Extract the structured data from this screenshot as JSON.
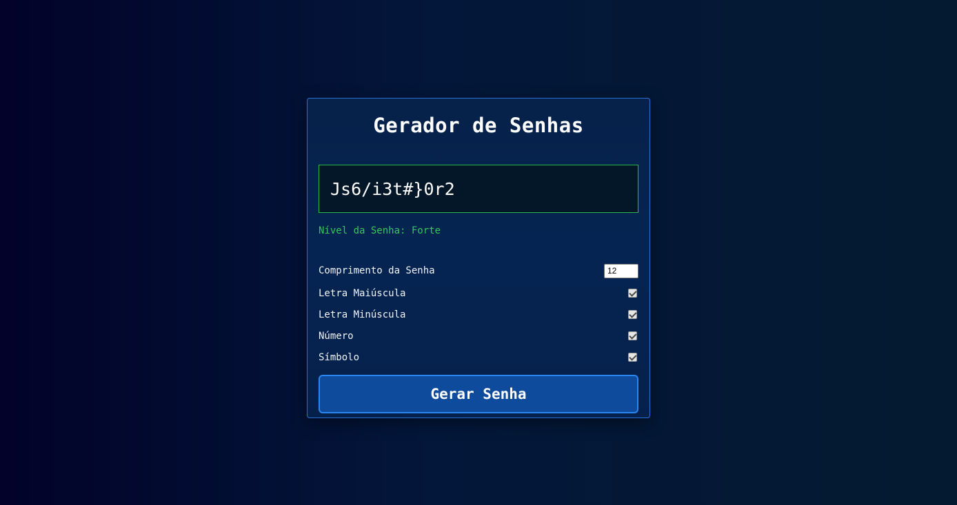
{
  "title": "Gerador de Senhas",
  "password": "Js6/i3t#}0r2",
  "strength": "Nível da Senha: Forte",
  "options": {
    "length": {
      "label": "Comprimento da Senha",
      "value": "12"
    },
    "uppercase": {
      "label": "Letra Maiúscula",
      "checked": true
    },
    "lowercase": {
      "label": "Letra Minúscula",
      "checked": true
    },
    "numbers": {
      "label": "Número",
      "checked": true
    },
    "symbols": {
      "label": "Símbolo",
      "checked": true
    }
  },
  "button_label": "Gerar Senha",
  "colors": {
    "accent": "#2a6fd6",
    "strong": "#35c75a",
    "button": "#0e4b9c"
  }
}
